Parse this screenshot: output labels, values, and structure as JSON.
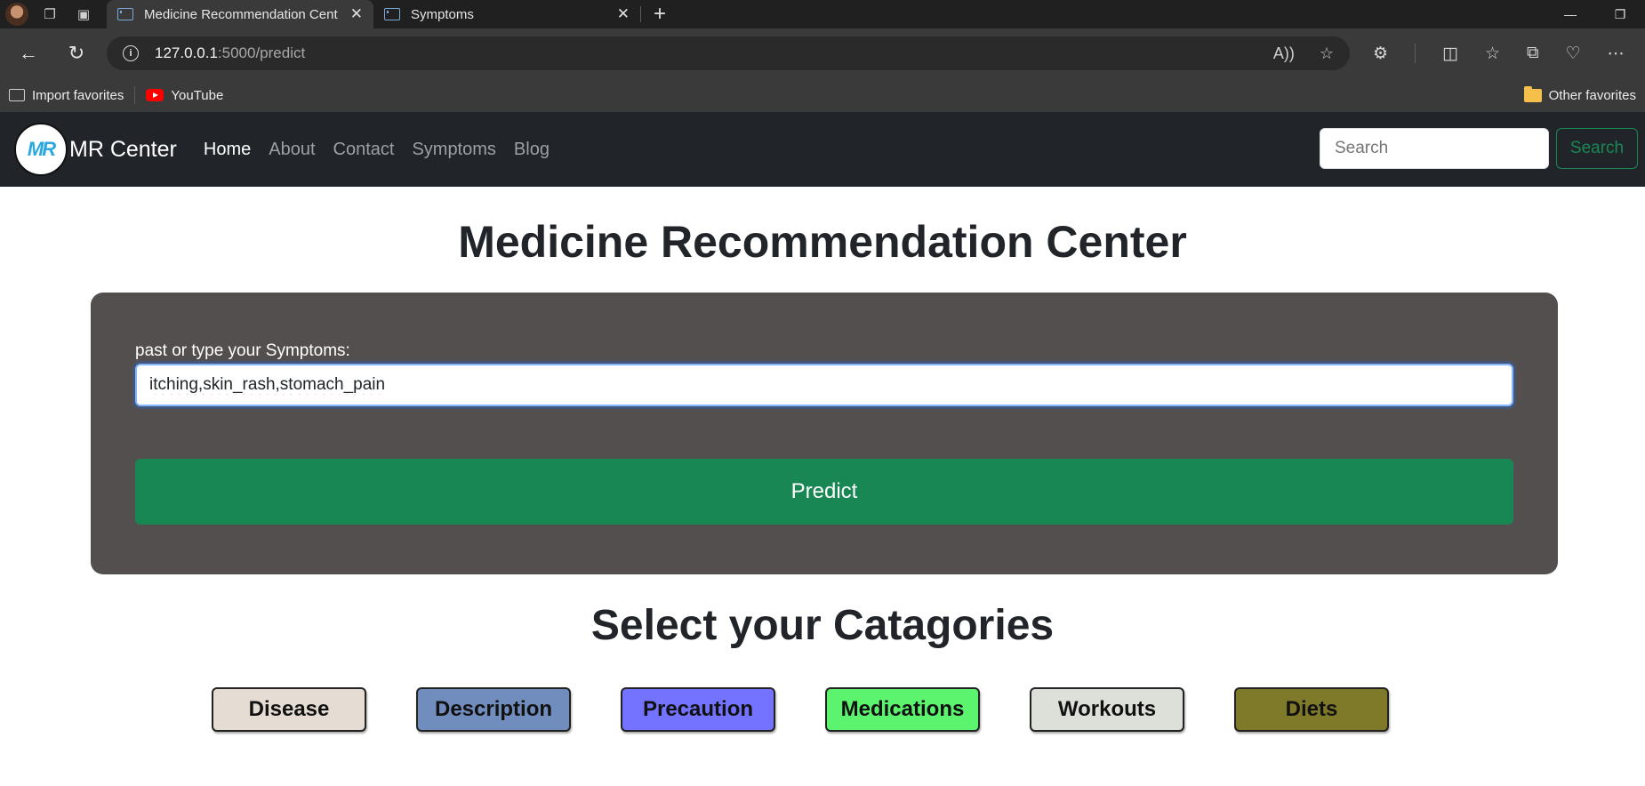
{
  "browser": {
    "tabs": [
      {
        "title": "Medicine Recommendation Cent",
        "active": true
      },
      {
        "title": "Symptoms",
        "active": false
      }
    ],
    "new_tab": "+",
    "url_host": "127.0.0.1",
    "url_path": ":5000/predict",
    "favorites": {
      "import": "Import favorites",
      "youtube": "YouTube",
      "other": "Other favorites"
    }
  },
  "navbar": {
    "logo_text": "MR",
    "brand": "MR Center",
    "links": [
      "Home",
      "About",
      "Contact",
      "Symptoms",
      "Blog"
    ],
    "search_placeholder": "Search",
    "search_button": "Search"
  },
  "main": {
    "title": "Medicine Recommendation Center",
    "form": {
      "label": "past or type your Symptoms:",
      "input_value": "itching,skin_rash,stomach_pain",
      "predict_button": "Predict"
    },
    "categories_title": "Select your Catagories",
    "categories": [
      {
        "label": "Disease",
        "color": "#e5dcd3"
      },
      {
        "label": "Description",
        "color": "#708dbd"
      },
      {
        "label": "Precaution",
        "color": "#7373ff"
      },
      {
        "label": "Medications",
        "color": "#5cf36f"
      },
      {
        "label": "Workouts",
        "color": "#dde0d8"
      },
      {
        "label": "Diets",
        "color": "#7f7a29"
      }
    ]
  },
  "colors": {
    "navbar_bg": "#212529",
    "card_bg": "#544f4f",
    "predict_green": "#198754"
  }
}
